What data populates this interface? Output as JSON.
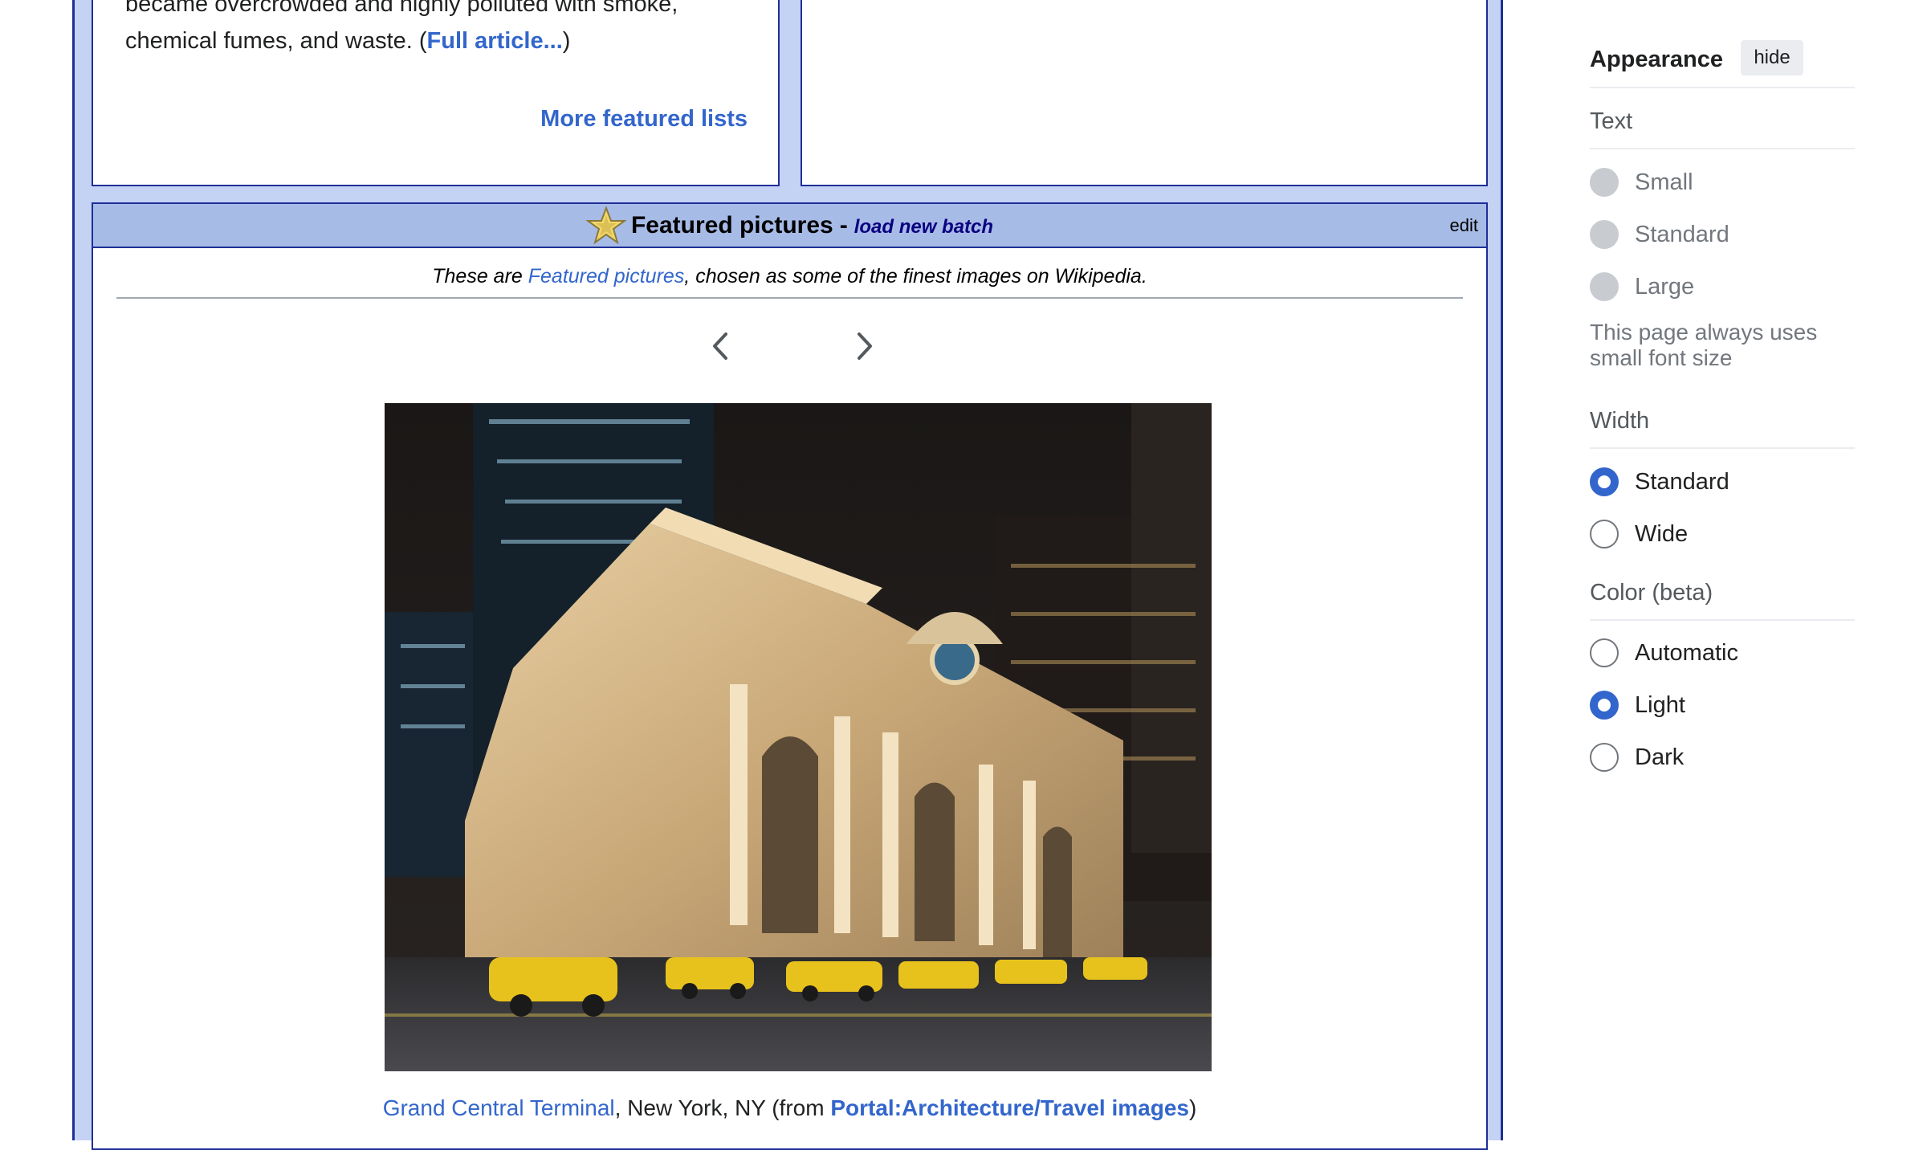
{
  "featured_list": {
    "text_line1": "became overcrowded and highly polluted with smoke,",
    "text_line2_prefix": "chemical fumes, and waste. (",
    "full_article_link": "Full article...",
    "text_line2_suffix": ")",
    "more_link": "More featured lists"
  },
  "featured_pictures": {
    "title": "Featured pictures",
    "separator": "-",
    "load_new_batch": "load new batch",
    "edit": "edit",
    "intro_prefix": "These are ",
    "intro_link": "Featured pictures",
    "intro_suffix": ", chosen as some of the finest images on Wikipedia.",
    "caption_link": "Grand Central Terminal",
    "caption_middle": ", New York, NY (from ",
    "caption_portal_link": "Portal:Architecture/Travel images",
    "caption_suffix": ")",
    "icons": {
      "star": "featured-star-icon",
      "prev": "chevron-left-icon",
      "next": "chevron-right-icon"
    }
  },
  "appearance": {
    "title": "Appearance",
    "hide_button": "hide",
    "text_section": {
      "label": "Text",
      "options": [
        {
          "label": "Small",
          "state": "disabled"
        },
        {
          "label": "Standard",
          "state": "disabled"
        },
        {
          "label": "Large",
          "state": "disabled"
        }
      ],
      "note": "This page always uses small font size"
    },
    "width_section": {
      "label": "Width",
      "options": [
        {
          "label": "Standard",
          "selected": true
        },
        {
          "label": "Wide",
          "selected": false
        }
      ]
    },
    "color_section": {
      "label": "Color (beta)",
      "options": [
        {
          "label": "Automatic",
          "selected": false
        },
        {
          "label": "Light",
          "selected": true
        },
        {
          "label": "Dark",
          "selected": false
        }
      ]
    }
  },
  "colors": {
    "portal_border": "#1e2f97",
    "portal_bg": "#c4d2f4",
    "header_bg": "#a7bbe7",
    "link": "#3366cc",
    "radio_selected": "#3366cc"
  }
}
